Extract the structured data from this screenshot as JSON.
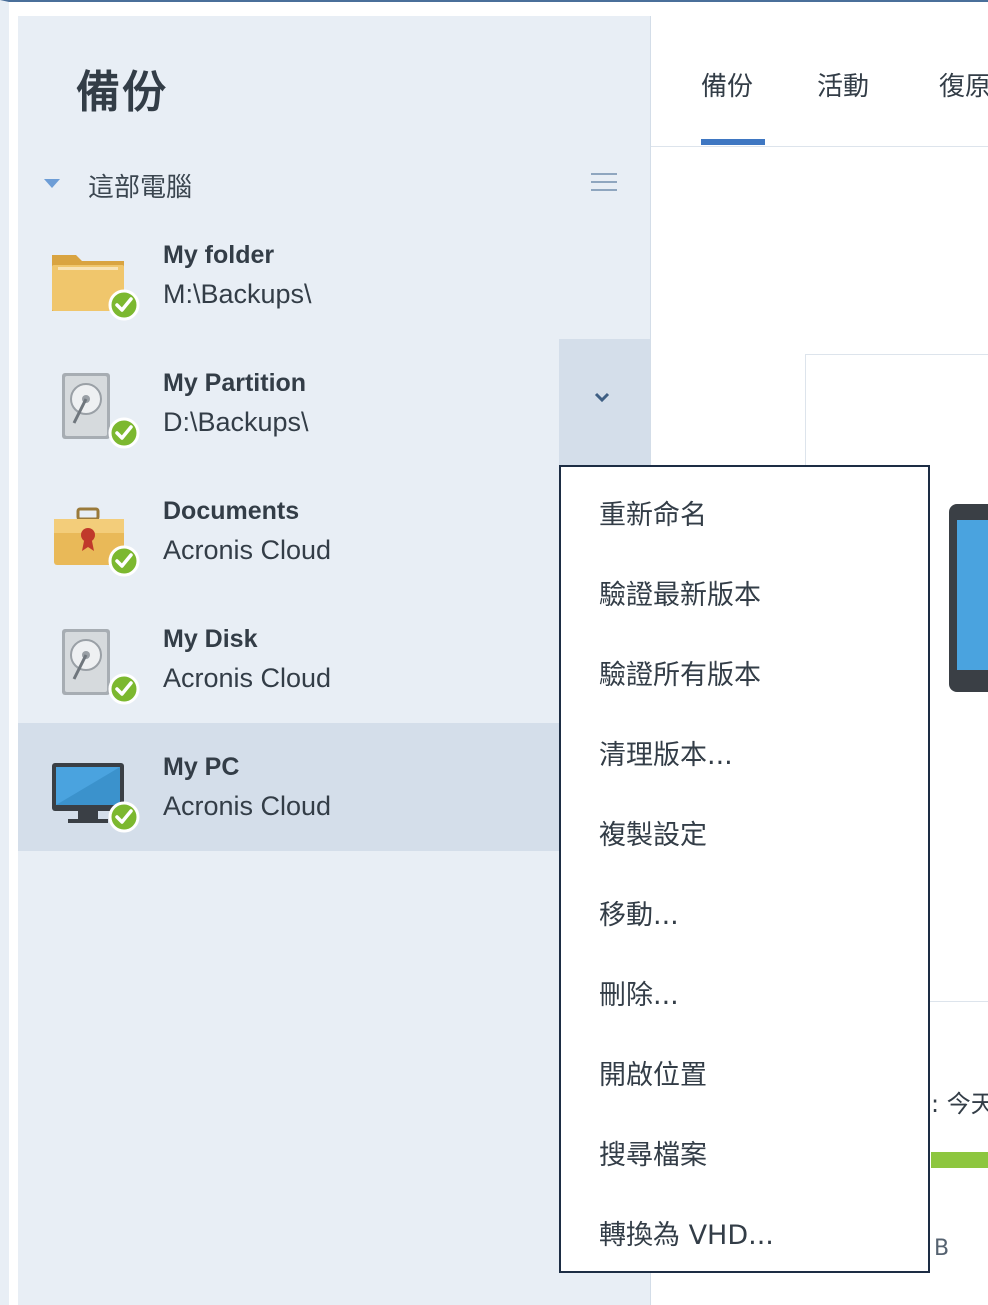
{
  "sidebar": {
    "title": "備份",
    "section_label": "這部電腦",
    "items": [
      {
        "name": "My folder",
        "location": "M:\\Backups\\",
        "icon": "folder-icon"
      },
      {
        "name": "My Partition",
        "location": "D:\\Backups\\",
        "icon": "hard-disk-icon"
      },
      {
        "name": "Documents",
        "location": "Acronis Cloud",
        "icon": "briefcase-icon"
      },
      {
        "name": "My Disk",
        "location": "Acronis Cloud",
        "icon": "hard-disk-icon"
      },
      {
        "name": "My PC",
        "location": "Acronis Cloud",
        "icon": "monitor-icon"
      }
    ]
  },
  "tabs": [
    {
      "label": "備份"
    },
    {
      "label": "活動"
    },
    {
      "label": "復原"
    }
  ],
  "main": {
    "status_text": ": 今天",
    "size_text": "B"
  },
  "context_menu": {
    "items": [
      {
        "label": "重新命名"
      },
      {
        "label": "驗證最新版本"
      },
      {
        "label": "驗證所有版本"
      },
      {
        "label": "清理版本..."
      },
      {
        "label": "複製設定"
      },
      {
        "label": "移動..."
      },
      {
        "label": "刪除..."
      },
      {
        "label": "開啟位置"
      },
      {
        "label": "搜尋檔案"
      },
      {
        "label": "轉換為 VHD..."
      }
    ]
  },
  "colors": {
    "sidebar_bg": "#e8eef5",
    "selected_bg": "#d4deea",
    "accent": "#3f77c2",
    "success": "#7cb82f",
    "menu_border": "#1d2d44"
  }
}
